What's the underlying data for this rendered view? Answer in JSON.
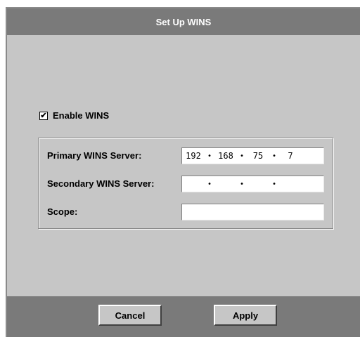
{
  "window": {
    "title": "Set Up WINS"
  },
  "enable": {
    "checked": true,
    "check_glyph": "✔",
    "label": "Enable WINS"
  },
  "fields": {
    "primary": {
      "label": "Primary WINS Server:",
      "octets": [
        "192",
        "168",
        "75",
        "7"
      ]
    },
    "secondary": {
      "label": "Secondary WINS Server:",
      "octets": [
        "",
        "",
        "",
        ""
      ]
    },
    "scope": {
      "label": "Scope:",
      "value": ""
    }
  },
  "ip_separator": "•",
  "buttons": {
    "cancel": "Cancel",
    "apply": "Apply"
  },
  "colors": {
    "titlebar": "#7a7a7a",
    "panel": "#c6c6c6",
    "title_text": "#ffffff"
  }
}
